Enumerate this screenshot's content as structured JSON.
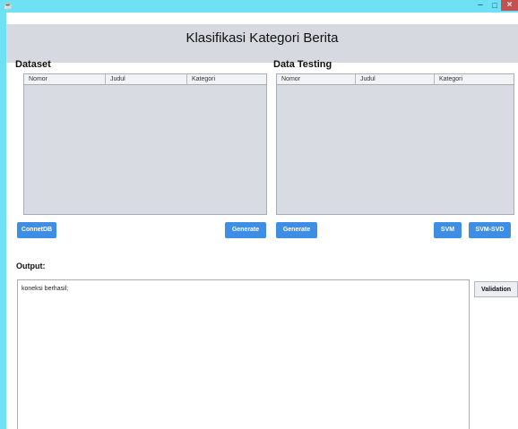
{
  "window": {
    "icon": "java-app-icon",
    "controls": {
      "minimize": "–",
      "maximize": "□",
      "close": "×"
    }
  },
  "header": {
    "title": "Klasifikasi Kategori Berita"
  },
  "dataset": {
    "title": "Dataset",
    "columns": [
      "Nomor",
      "Judul",
      "Kategori"
    ],
    "buttons": {
      "connect": "ConnetDB",
      "generate": "Generate"
    }
  },
  "testing": {
    "title": "Data Testing",
    "columns": [
      "Nomor",
      "Judul",
      "Kategori"
    ],
    "buttons": {
      "generate": "Generate",
      "svm": "SVM",
      "svm_svd": "SVM-SVD"
    }
  },
  "output": {
    "title": "Output:",
    "text": "koneksi berhasil;",
    "validation_button": "Validation"
  },
  "colors": {
    "titlebar": "#6ee1f5",
    "header_band": "#d6dae0",
    "button_blue": "#3f8ee6",
    "close_red": "#c7504f",
    "table_body": "#d8dce2"
  }
}
